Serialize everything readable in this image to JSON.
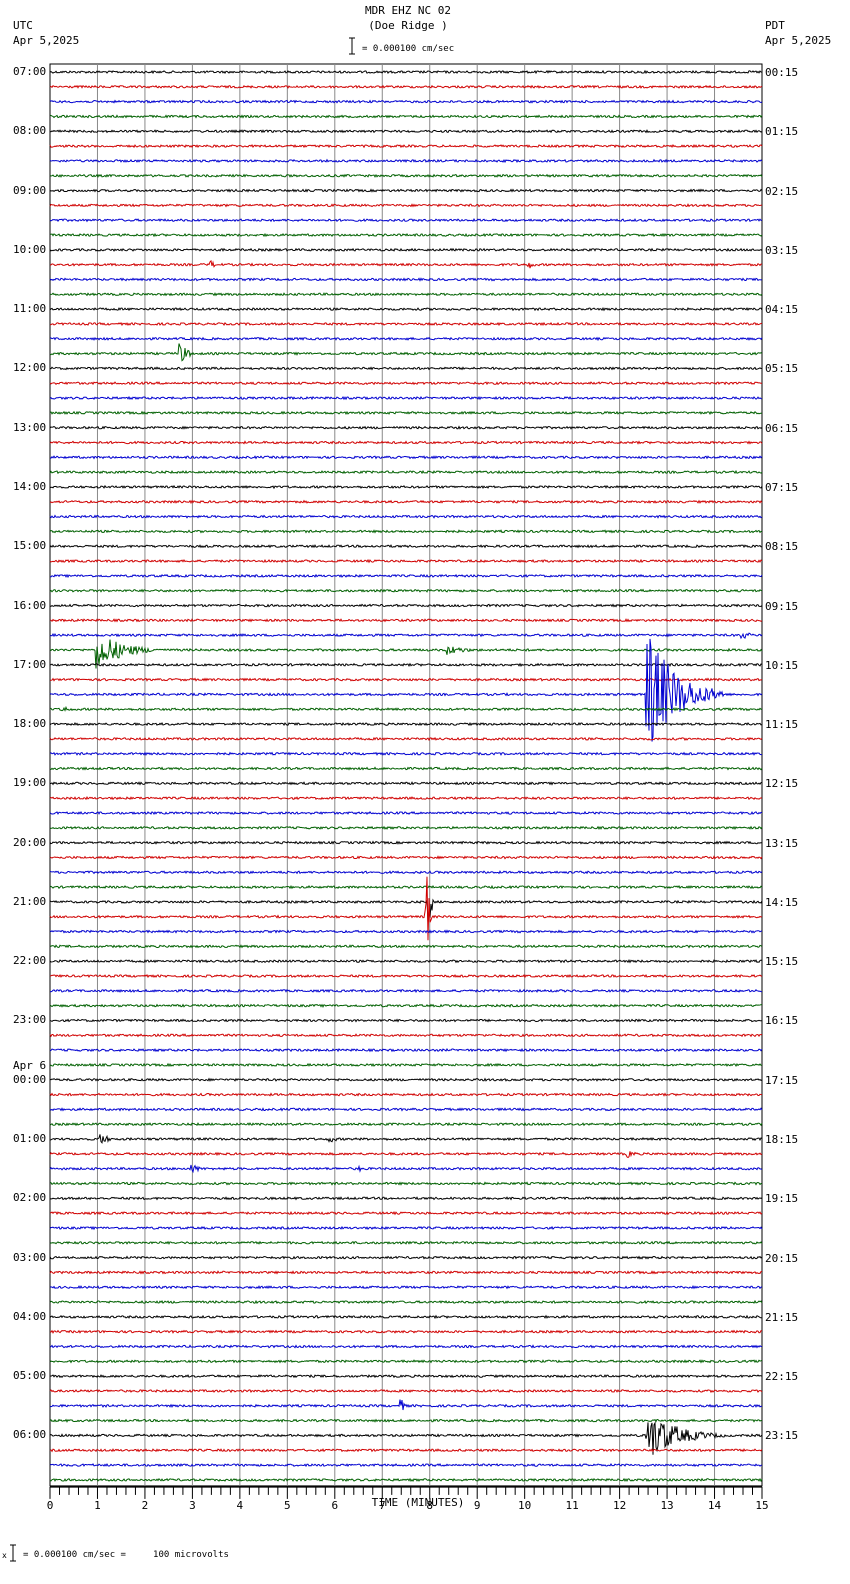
{
  "header": {
    "station": "MDR EHZ NC 02",
    "location": "(Doe Ridge )",
    "left_tz": "UTC",
    "left_date": "Apr 5,2025",
    "right_tz": "PDT",
    "right_date": "Apr 5,2025",
    "scale": "= 0.000100 cm/sec"
  },
  "footer": {
    "scale_prefix": "x",
    "scale": "= 0.000100 cm/sec =     100 microvolts"
  },
  "colors": [
    "#000000",
    "#d00000",
    "#0000d0",
    "#006000"
  ],
  "chart_data": {
    "type": "line",
    "title": "MDR EHZ NC 02 (Doe Ridge )",
    "xlabel": "TIME (MINUTES)",
    "xlim": [
      0,
      15
    ],
    "x_ticks": [
      "0",
      "1",
      "2",
      "3",
      "4",
      "5",
      "6",
      "7",
      "8",
      "9",
      "10",
      "11",
      "12",
      "13",
      "14",
      "15"
    ],
    "traces_per_hour": 4,
    "trace_count": 96,
    "left_labels": [
      "07:00",
      "08:00",
      "09:00",
      "10:00",
      "11:00",
      "12:00",
      "13:00",
      "14:00",
      "15:00",
      "16:00",
      "17:00",
      "18:00",
      "19:00",
      "20:00",
      "21:00",
      "22:00",
      "23:00",
      "00:00",
      "01:00",
      "02:00",
      "03:00",
      "04:00",
      "05:00",
      "06:00"
    ],
    "day_change_label": "Apr 6",
    "right_labels": [
      "00:15",
      "01:15",
      "02:15",
      "03:15",
      "04:15",
      "05:15",
      "06:15",
      "07:15",
      "08:15",
      "09:15",
      "10:15",
      "11:15",
      "12:15",
      "13:15",
      "14:15",
      "15:15",
      "16:15",
      "17:15",
      "18:15",
      "19:15",
      "20:15",
      "21:15",
      "22:15",
      "23:15"
    ],
    "events": [
      {
        "trace": 13,
        "minute": 3.4,
        "amp": 4,
        "dur": 0.3
      },
      {
        "trace": 13,
        "minute": 10.1,
        "amp": 4,
        "dur": 0.3
      },
      {
        "trace": 19,
        "minute": 2.75,
        "amp": 12,
        "dur": 0.35
      },
      {
        "trace": 38,
        "minute": 14.6,
        "amp": 4,
        "dur": 0.5
      },
      {
        "trace": 39,
        "minute": 1.0,
        "amp": 20,
        "dur": 1.4
      },
      {
        "trace": 39,
        "minute": 8.4,
        "amp": 5,
        "dur": 1.0
      },
      {
        "trace": 42,
        "minute": 12.6,
        "amp": 65,
        "dur": 1.6
      },
      {
        "trace": 43,
        "minute": 0.3,
        "amp": 4,
        "dur": 0.3
      },
      {
        "trace": 57,
        "minute": 7.95,
        "amp": 50,
        "dur": 0.08
      },
      {
        "trace": 56,
        "minute": 8.0,
        "amp": 30,
        "dur": 0.08
      },
      {
        "trace": 72,
        "minute": 1.1,
        "amp": 7,
        "dur": 0.3
      },
      {
        "trace": 72,
        "minute": 5.9,
        "amp": 4,
        "dur": 0.4
      },
      {
        "trace": 73,
        "minute": 12.2,
        "amp": 4,
        "dur": 0.4
      },
      {
        "trace": 74,
        "minute": 3.0,
        "amp": 5,
        "dur": 0.4
      },
      {
        "trace": 74,
        "minute": 6.5,
        "amp": 4,
        "dur": 0.2
      },
      {
        "trace": 90,
        "minute": 7.4,
        "amp": 7,
        "dur": 0.2
      },
      {
        "trace": 92,
        "minute": 12.6,
        "amp": 26,
        "dur": 1.6
      }
    ]
  }
}
